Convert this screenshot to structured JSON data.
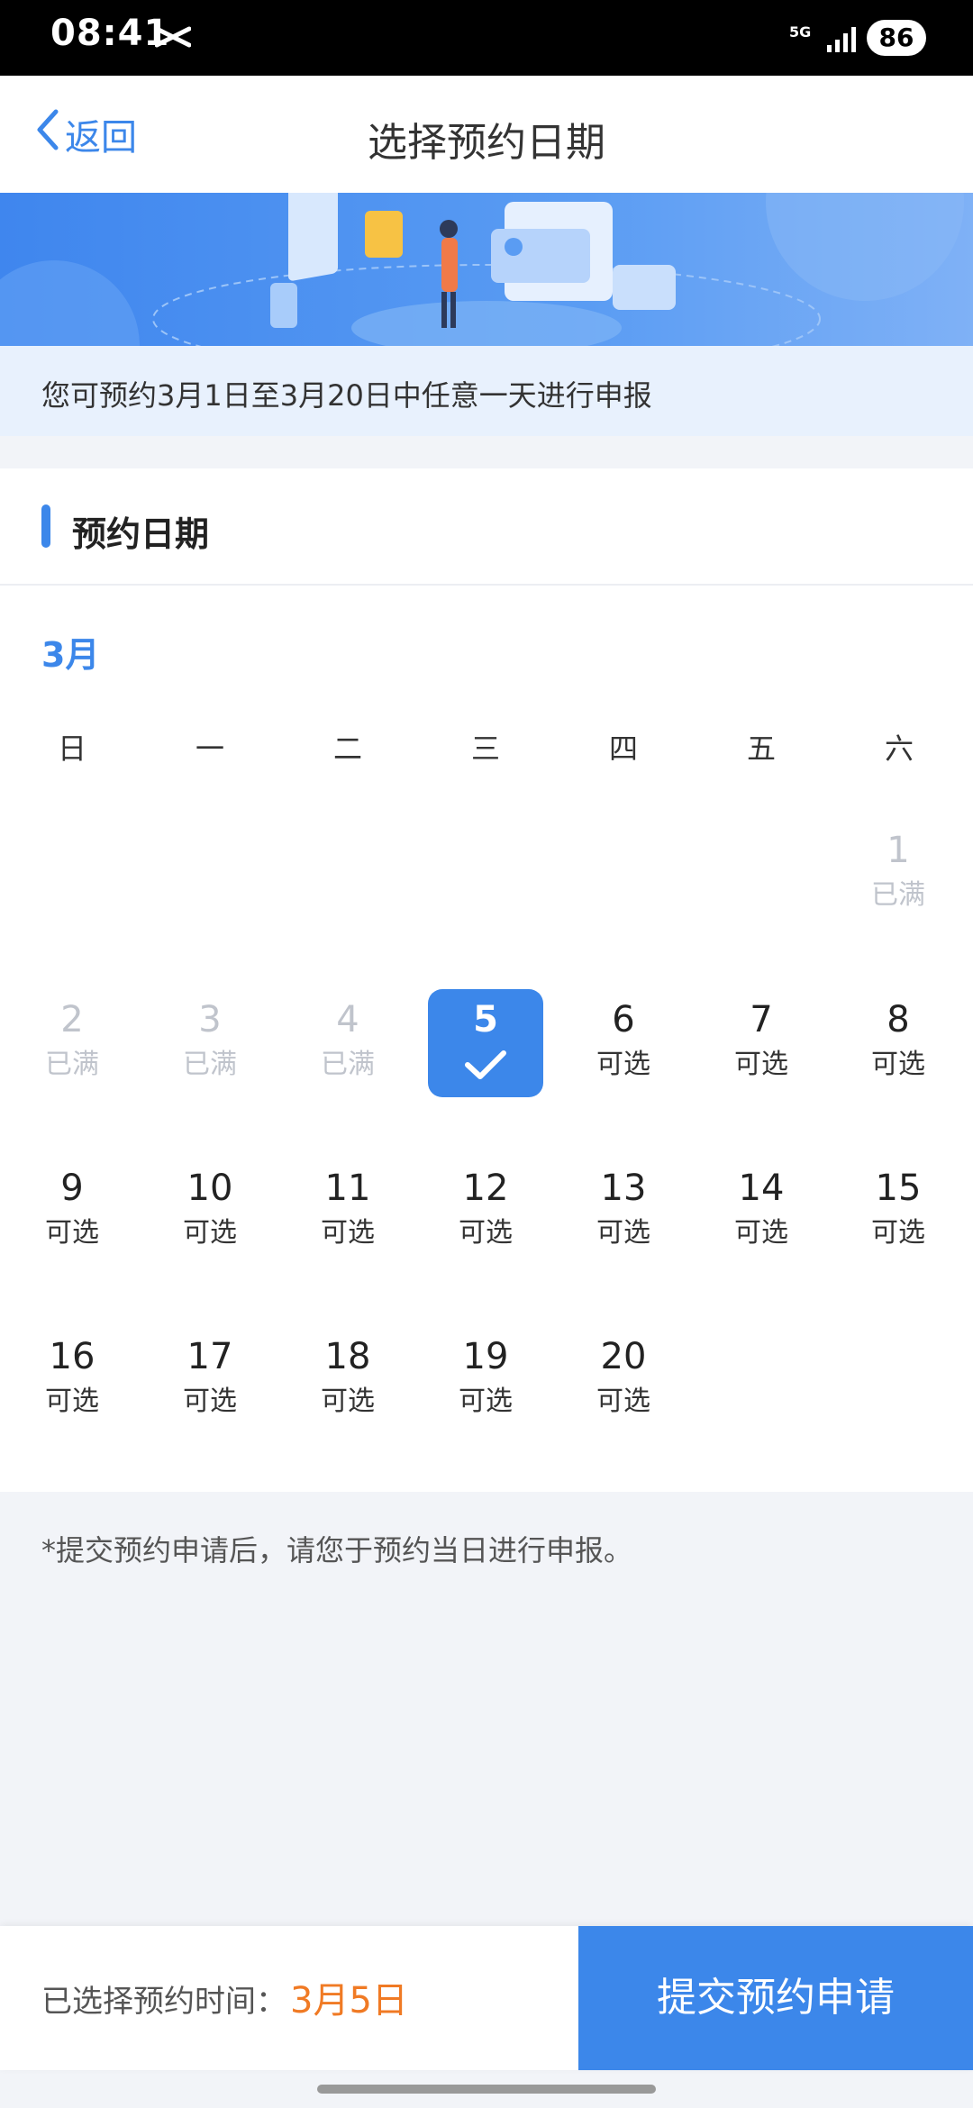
{
  "status_bar": {
    "time": "08:41",
    "network": "5G",
    "battery": "86"
  },
  "nav": {
    "back_label": "返回",
    "title": "选择预约日期"
  },
  "notice": "您可预约3月1日至3月20日中任意一天进行申报",
  "section_title": "预约日期",
  "calendar": {
    "month_label": "3月",
    "weekdays": [
      "日",
      "一",
      "二",
      "三",
      "四",
      "五",
      "六"
    ],
    "days": [
      {
        "num": "1",
        "status": "已满"
      },
      {
        "num": "2",
        "status": "已满"
      },
      {
        "num": "3",
        "status": "已满"
      },
      {
        "num": "4",
        "status": "已满"
      },
      {
        "num": "5",
        "status": ""
      },
      {
        "num": "6",
        "status": "可选"
      },
      {
        "num": "7",
        "status": "可选"
      },
      {
        "num": "8",
        "status": "可选"
      },
      {
        "num": "9",
        "status": "可选"
      },
      {
        "num": "10",
        "status": "可选"
      },
      {
        "num": "11",
        "status": "可选"
      },
      {
        "num": "12",
        "status": "可选"
      },
      {
        "num": "13",
        "status": "可选"
      },
      {
        "num": "14",
        "status": "可选"
      },
      {
        "num": "15",
        "status": "可选"
      },
      {
        "num": "16",
        "status": "可选"
      },
      {
        "num": "17",
        "status": "可选"
      },
      {
        "num": "18",
        "status": "可选"
      },
      {
        "num": "19",
        "status": "可选"
      },
      {
        "num": "20",
        "status": "可选"
      }
    ],
    "selected_day": "5"
  },
  "footnote": "*提交预约申请后，请您于预约当日进行申报。",
  "bottom": {
    "selected_label": "已选择预约时间：",
    "selected_value": "3月5日",
    "submit_label": "提交预约申请"
  },
  "colors": {
    "accent": "#3c87ea",
    "selected_text": "#f07a24",
    "full_text": "#c0c4cc"
  }
}
